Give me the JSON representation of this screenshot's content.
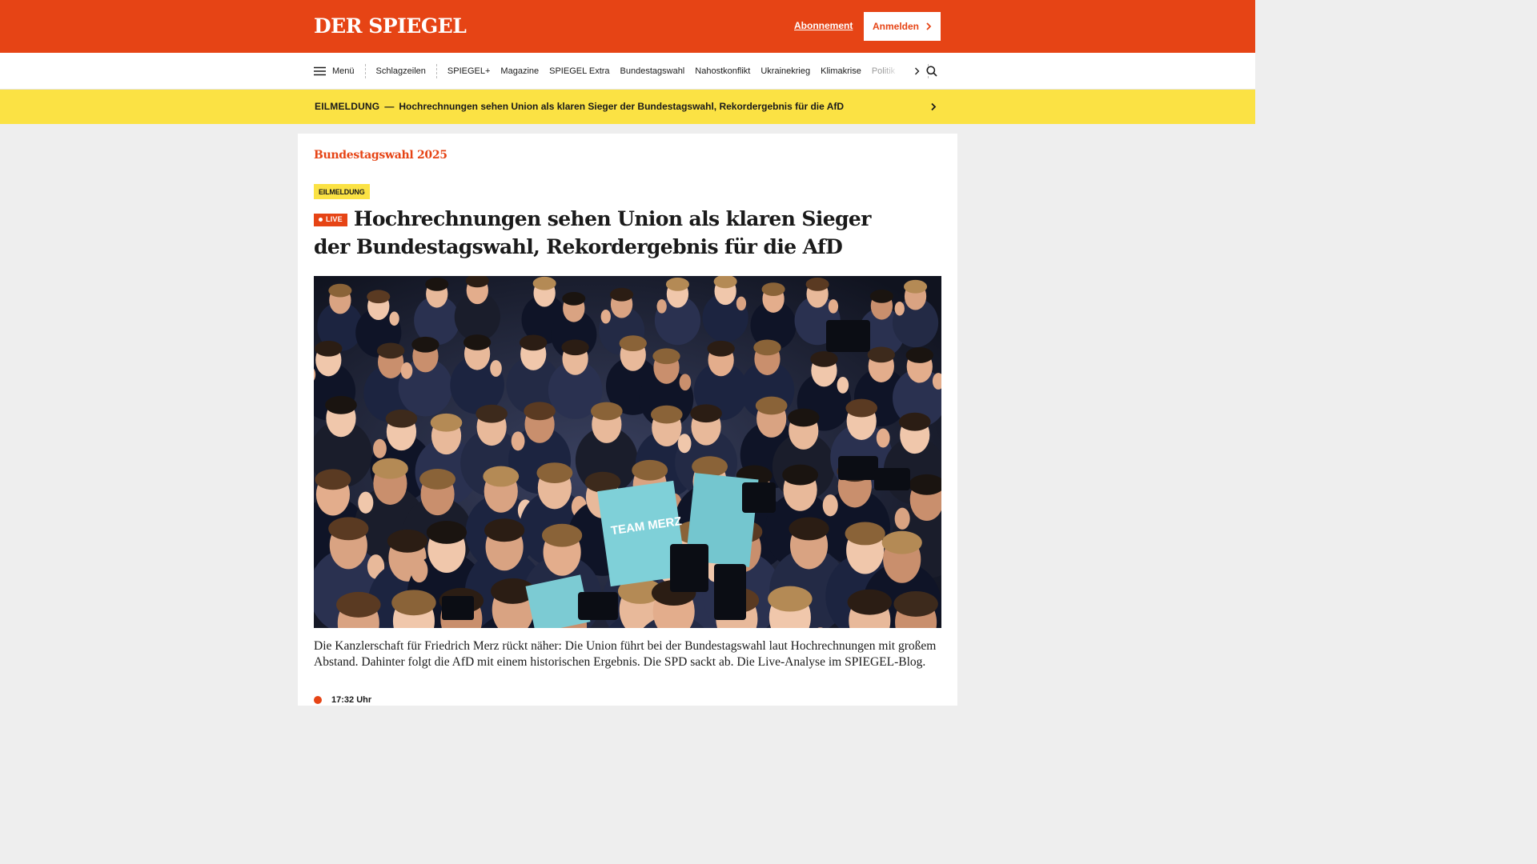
{
  "header": {
    "logo_text": "DER SPIEGEL",
    "subscription_link": "Abonnement",
    "login_button": "Anmelden"
  },
  "nav": {
    "menu_label": "Menü",
    "headlines_label": "Schlagzeilen",
    "items": [
      "SPIEGEL+",
      "Magazine",
      "SPIEGEL Extra",
      "Bundestagswahl",
      "Nahostkonflikt",
      "Ukrainekrieg",
      "Klimakrise"
    ],
    "truncated_item": "Politik"
  },
  "breaking": {
    "label": "EILMELDUNG",
    "separator": "—",
    "text": "Hochrechnungen sehen Union als klaren Sieger der Bundestagswahl, Rekordergebnis für die AfD"
  },
  "article": {
    "kicker": "Bundestagswahl 2025",
    "badge": "EILMELDUNG",
    "live_label": "LIVE",
    "headline": "Hochrechnungen sehen Union als klaren Sieger der Bundestagswahl, Rekordergebnis für die AfD",
    "photo_sign_text": "TEAM MERZ",
    "teaser": "Die Kanzlerschaft für Friedrich Merz rückt näher: Die Union führt bei der Bundestagswahl laut Hochrechnungen mit großem Abstand. Dahinter folgt die AfD mit einem historischen Ergebnis. Die SPD sackt ab. Die Live-Analyse im SPIEGEL-Blog.",
    "time": "17:32 Uhr"
  },
  "colors": {
    "brand_red": "#e64415",
    "breaking_yellow": "#fbe244",
    "sign_teal": "#7fd0d8"
  }
}
